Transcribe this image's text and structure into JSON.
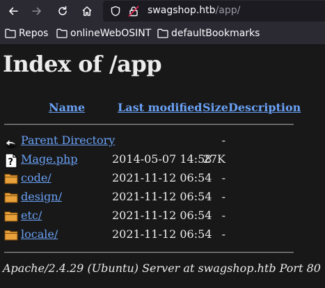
{
  "browser": {
    "url_host": "swagshop.htb",
    "url_path": "/app/",
    "bookmarks": [
      {
        "label": "Repos",
        "icon": "folder-icon"
      },
      {
        "label": "onlineWebOSINT",
        "icon": "folder-icon"
      },
      {
        "label": "defaultBookmarks",
        "icon": "folder-icon"
      }
    ]
  },
  "page": {
    "title": "Index of /app",
    "columns": {
      "name": "Name",
      "modified": "Last modified",
      "size": "Size",
      "description": "Description"
    },
    "entries": [
      {
        "name": "Parent Directory",
        "modified": "",
        "size": "-",
        "icon": "back-icon"
      },
      {
        "name": "Mage.php",
        "modified": "2014-05-07 14:58",
        "size": "27K",
        "icon": "unknown-file-icon"
      },
      {
        "name": "code/",
        "modified": "2021-11-12 06:54",
        "size": "-",
        "icon": "folder-icon"
      },
      {
        "name": "design/",
        "modified": "2021-11-12 06:54",
        "size": "-",
        "icon": "folder-icon"
      },
      {
        "name": "etc/",
        "modified": "2021-11-12 06:54",
        "size": "-",
        "icon": "folder-icon"
      },
      {
        "name": "locale/",
        "modified": "2021-11-12 06:54",
        "size": "-",
        "icon": "folder-icon"
      }
    ],
    "footer": "Apache/2.4.29 (Ubuntu) Server at swagshop.htb Port 80"
  },
  "colors": {
    "link": "#6aa1f5",
    "background": "#181818",
    "text": "#ececec"
  }
}
